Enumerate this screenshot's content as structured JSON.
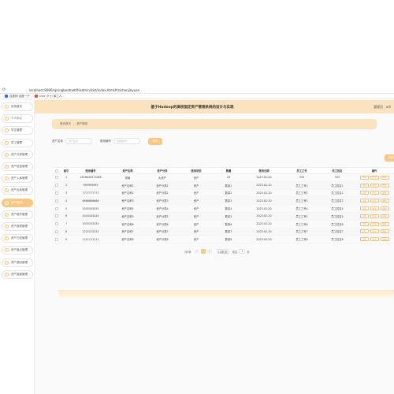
{
  "browser": {
    "url": "localhost:8080/springbootnetf4/admin/dist/index.html#/zichanjieyuan",
    "bookmarks": [
      {
        "label": "百度网·百度一下",
        "color": "#2f6de0"
      },
      {
        "label": "cnzz 小·小 库工人...",
        "color": "#e74c3c"
      }
    ]
  },
  "header": {
    "title": "基于Hadoop的高校固定资产管理系统的设计与实现",
    "user": "管理员 · adi"
  },
  "sidebar": {
    "items": [
      {
        "label": "系统首页"
      },
      {
        "label": "个人中心"
      },
      {
        "label": "学生管理"
      },
      {
        "label": "员工管理"
      },
      {
        "label": "资产分类管理"
      },
      {
        "label": "资产信息管理"
      },
      {
        "label": "资产入库管理"
      },
      {
        "label": "资产出库管理"
      },
      {
        "label": "资产借用"
      },
      {
        "label": "资产维护管理"
      },
      {
        "label": "资产报损管理"
      },
      {
        "label": "资产归还管理"
      },
      {
        "label": "资产盘点管理"
      },
      {
        "label": "资产退回管理"
      },
      {
        "label": "资产报废管理"
      }
    ],
    "active_index": 8
  },
  "breadcrumb": {
    "home": "首页首页",
    "current": "资产借用"
  },
  "search": {
    "fields": [
      {
        "label": "资产名称",
        "placeholder": "资产名称"
      },
      {
        "label": "借用编号",
        "placeholder": "借用编号1"
      }
    ],
    "button": "查询"
  },
  "add_button": "新增",
  "table": {
    "columns": [
      "",
      "索引",
      "借用编号",
      "资产名称",
      "资产分类",
      "借用状态",
      "数量",
      "借用日期",
      "员工工号",
      "员工姓名",
      "操作"
    ],
    "rows": [
      [
        "1",
        "1676640971088",
        "风扇",
        "大资产",
        "资产",
        "20",
        "2023-02-20",
        "555",
        "555"
      ],
      [
        "2",
        "999999999",
        "资产名称1",
        "资产分类1",
        "资产",
        "数量1",
        "2023-02-20",
        "员工工号1",
        "员工姓名1"
      ],
      [
        "3",
        "7777777777",
        "资产名称2",
        "资产分类2",
        "资产",
        "数量2",
        "2023-02-20",
        "员工工号2",
        "员工姓名2"
      ],
      [
        "4",
        "6666666666",
        "资产名称3",
        "资产分类3",
        "资产",
        "数量3",
        "2023-02-20",
        "员工工号3",
        "员工姓名3"
      ],
      [
        "5",
        "5555555555",
        "资产名称4",
        "资产分类4",
        "资产",
        "数量4",
        "2023-02-20",
        "员工工号4",
        "员工姓名4"
      ],
      [
        "6",
        "4444444444",
        "资产名称5",
        "资产分类5",
        "资产",
        "数量5",
        "2023-02-20",
        "员工工号5",
        "员工姓名5"
      ],
      [
        "7",
        "3333333333",
        "资产名称6",
        "资产分类6",
        "资产",
        "数量6",
        "2023-02-20",
        "员工工号6",
        "员工姓名6"
      ],
      [
        "8",
        "2222222222",
        "资产名称7",
        "资产分类7",
        "资产",
        "数量7",
        "2023-02-20",
        "员工工号7",
        "员工姓名7"
      ],
      [
        "9",
        "1111111111",
        "资产名称8",
        "资产分类8",
        "资产",
        "数量8",
        "2023-02-20",
        "员工工号8",
        "员工姓名8"
      ]
    ],
    "ops": [
      "详情",
      "修改",
      "删除"
    ]
  },
  "pager": {
    "total": "共9条",
    "current_page": "1",
    "page_size": "10条/页",
    "goto_label": "前往",
    "goto_value": "1",
    "page_unit": "页"
  },
  "colors": {
    "accent": "#f8c781",
    "header_bg": "#fbe3bf"
  }
}
